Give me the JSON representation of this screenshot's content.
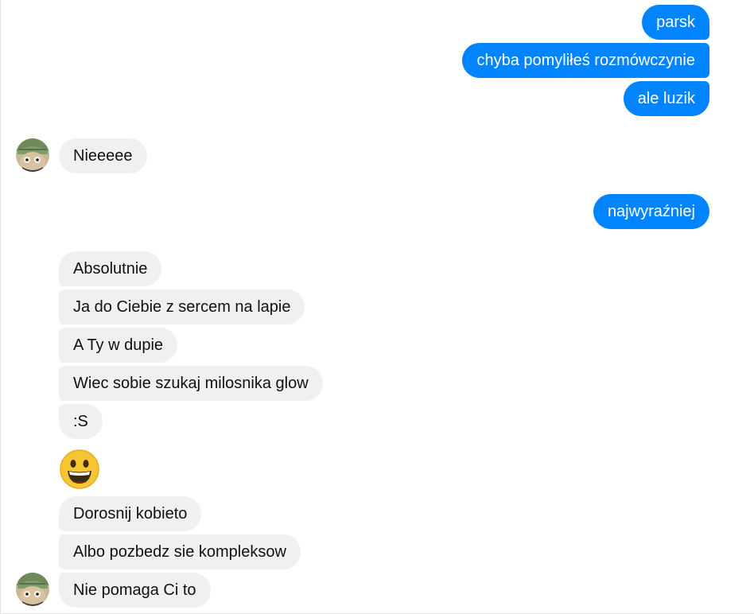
{
  "thread": {
    "outgoing_group_1": [
      "parsk",
      "chyba pomyliłeś rozmówczynie",
      "ale luzik"
    ],
    "incoming_1": "Nieeeee",
    "outgoing_2": "najwyraźniej",
    "incoming_group_2": [
      "Absolutnie",
      "Ja do Ciebie z sercem na lapie",
      "A Ty w dupie",
      "Wiec sobie szukaj milosnika glow",
      ":S"
    ],
    "incoming_group_3": [
      "Dorosnij kobieto",
      "Albo pozbedz sie kompleksow",
      "Nie pomaga Ci to"
    ]
  },
  "icons": {
    "avatar": "contact-avatar-icon",
    "emoji": "grinning-face-emoji-icon"
  },
  "colors": {
    "outgoing_bubble": "#0084ff",
    "incoming_bubble": "#f1f0f0",
    "outgoing_text": "#ffffff",
    "incoming_text": "#111111"
  }
}
